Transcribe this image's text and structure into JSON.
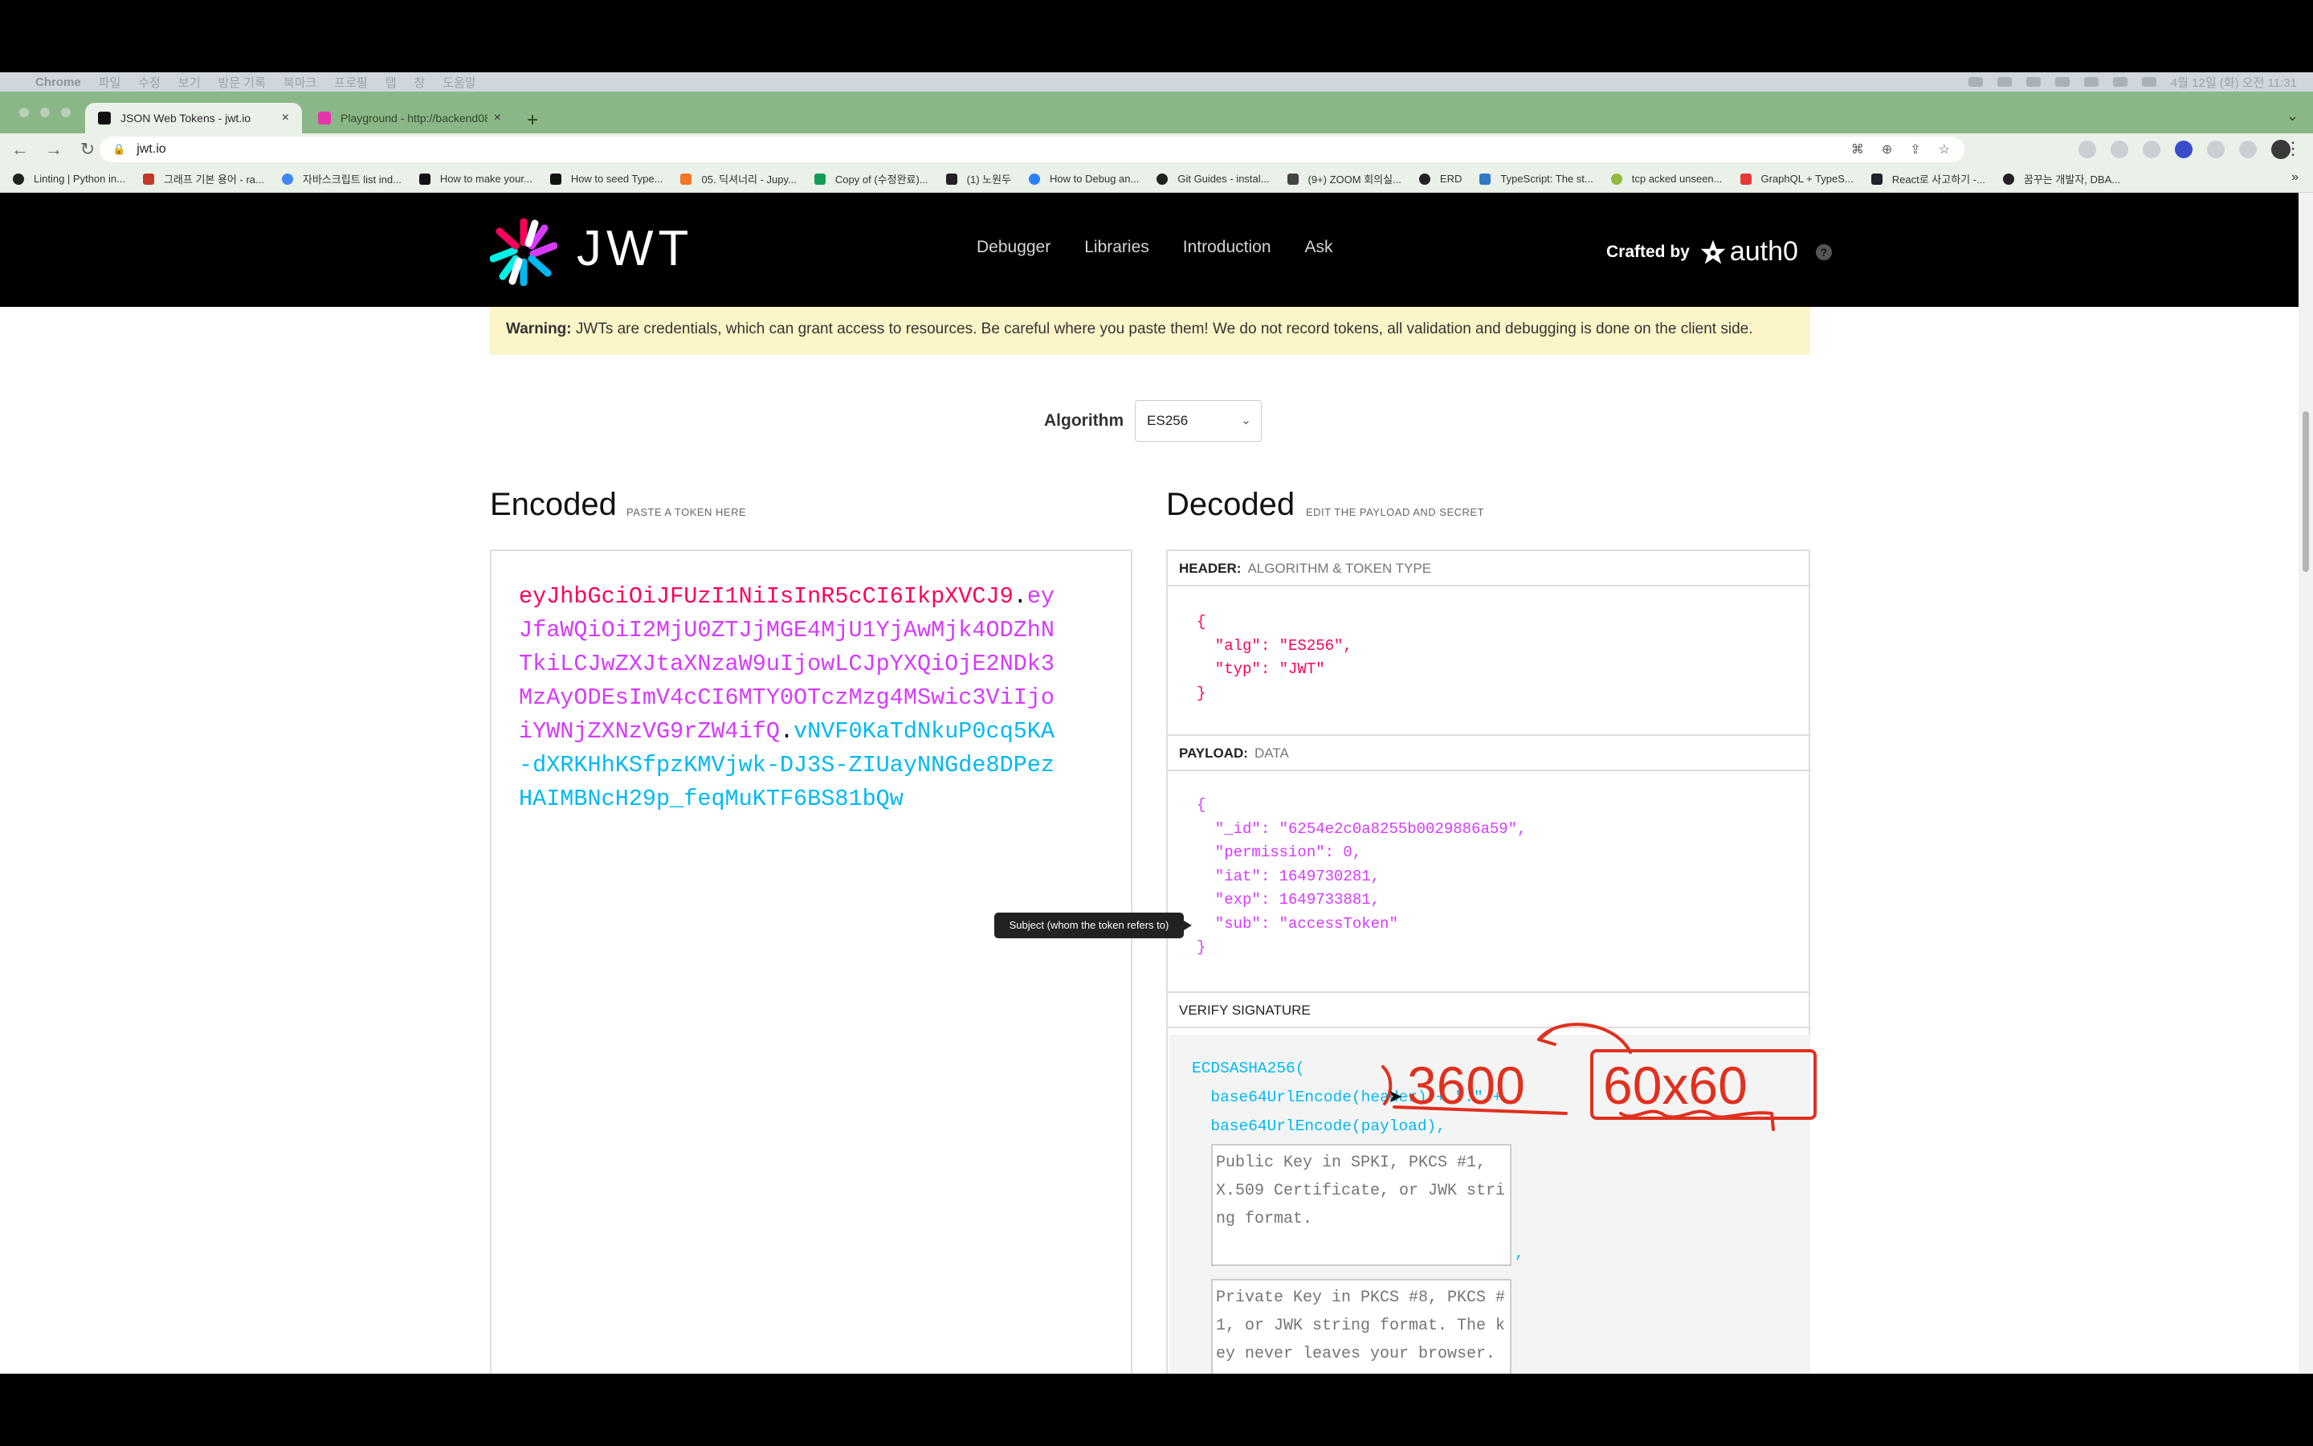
{
  "menubar": {
    "items": [
      "Chrome",
      "파일",
      "수정",
      "보기",
      "방문 기록",
      "북마크",
      "프로필",
      "탭",
      "창",
      "도움말"
    ],
    "clock": "4월 12일 (화) 오전 11:31"
  },
  "tabs": [
    {
      "title": "JSON Web Tokens - jwt.io",
      "active": true,
      "close": "×"
    },
    {
      "title": "Playground - http://backend08...",
      "active": false,
      "close": "×"
    }
  ],
  "newtab": "+",
  "address": {
    "url": "jwt.io"
  },
  "bookmarks": [
    "Linting | Python in...",
    "그래프 기본 용어 - ra...",
    "자바스크립트 list ind...",
    "How to make your...",
    "How to seed Type...",
    "05. 딕셔너리 - Jupy...",
    "Copy of (수정완료)...",
    "(1) 노원두",
    "How to Debug an...",
    "Git Guides - instal...",
    "(9+) ZOOM 회의실...",
    "ERD",
    "TypeScript: The st...",
    "tcp acked unseen...",
    "GraphQL + TypeS...",
    "React로 사고하기 -...",
    "꿈꾸는 개발자, DBA..."
  ],
  "site": {
    "logo_text": "JWT",
    "nav": [
      "Debugger",
      "Libraries",
      "Introduction",
      "Ask"
    ],
    "crafted_by": "Crafted by",
    "brand": "auth0",
    "help": "?"
  },
  "warning": {
    "label": "Warning:",
    "text": "JWTs are credentials, which can grant access to resources. Be careful where you paste them! We do not record tokens, all validation and debugging is done on the client side."
  },
  "algorithm": {
    "label": "Algorithm",
    "value": "ES256",
    "chevron": "⌄"
  },
  "encoded": {
    "title": "Encoded",
    "subtitle": "PASTE A TOKEN HERE",
    "header_part": "eyJhbGciOiJFUzI1NiIsInR5cCI6IkpXVCJ9",
    "payload_part": "eyJfaWQiOiI2MjU0ZTJjMGE4MjU1YjAwMjk4ODZhNTkiLCJwZXJtaXNzaW9uIjowLCJpYXQiOjE2NDk3MzAyODEsImV4cCI6MTY0OTczMzg4MSwic3ViIjoiYWNjZXNzVG9rZW4ifQ",
    "signature_part": "vNVF0KaTdNkuP0cq5KA-dXRKHhKSfpzKMVjwk-DJ3S-ZIUayNNGde8DPezHAIMBNcH29p_feqMuKTF6BS81bQw",
    "dot": "."
  },
  "decoded": {
    "title": "Decoded",
    "subtitle": "EDIT THE PAYLOAD AND SECRET",
    "header": {
      "label": "HEADER:",
      "sub": "ALGORITHM & TOKEN TYPE",
      "lines": [
        "{",
        "  \"alg\": \"ES256\",",
        "  \"typ\": \"JWT\"",
        "}"
      ]
    },
    "payload": {
      "label": "PAYLOAD:",
      "sub": "DATA",
      "lines": [
        "{",
        "  \"_id\": \"6254e2c0a8255b0029886a59\",",
        "  \"permission\": 0,",
        "  \"iat\": 1649730281,",
        "  \"exp\": 1649733881,",
        "  \"sub\": \"accessToken\"",
        "}"
      ]
    },
    "verify": {
      "label": "VERIFY SIGNATURE",
      "fn": "ECDSASHA256(",
      "arg1": "  base64UrlEncode(header) + \".\" +",
      "arg2": "  base64UrlEncode(payload),",
      "public_key_placeholder": "Public Key in SPKI, PKCS #1, X.509 Certificate, or JWK string format.",
      "private_key_placeholder": "Private Key in PKCS #8, PKCS #1, or JWK string format. The key never leaves your browser.",
      "comma": ","
    }
  },
  "tooltip": "Subject (whom the token refers to)",
  "annotation": {
    "left_text": "3600",
    "right_text": "60x60",
    "color": "#e0301e"
  }
}
